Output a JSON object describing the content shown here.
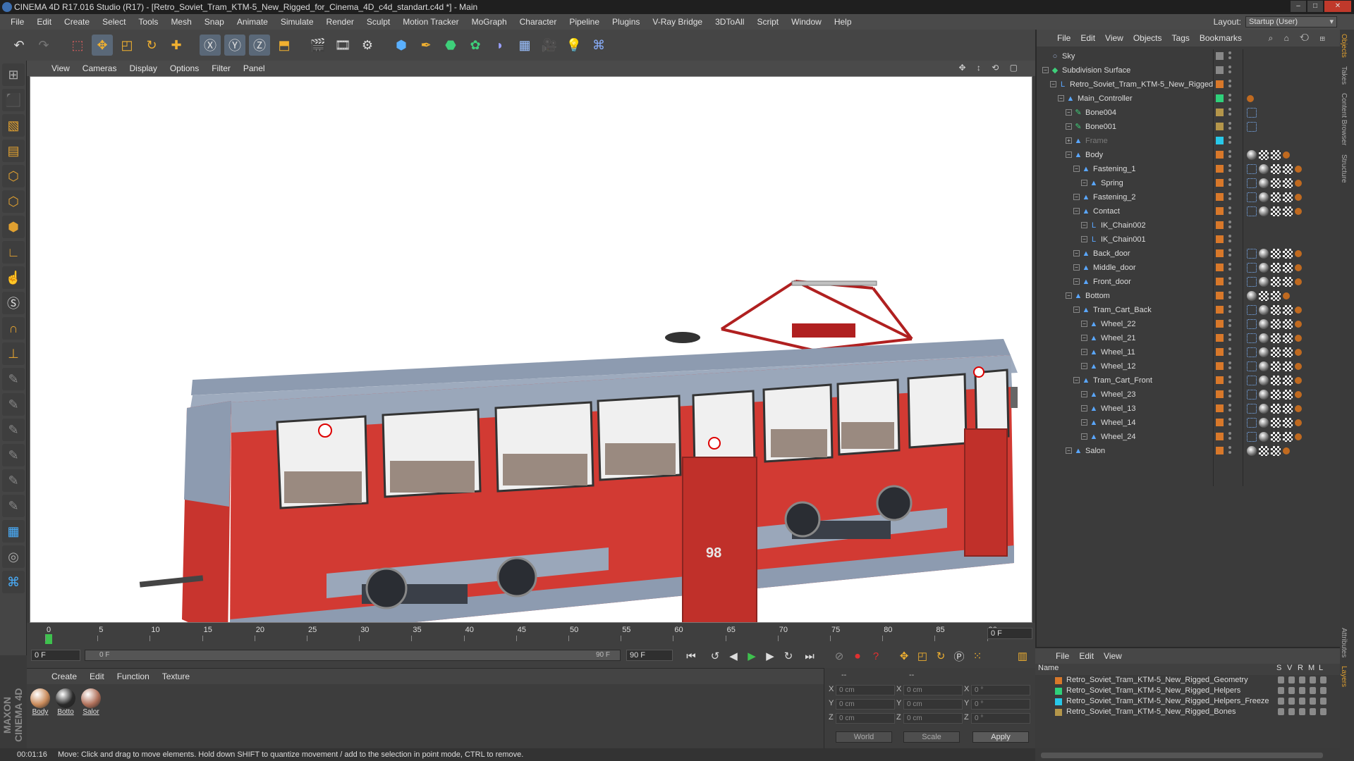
{
  "window": {
    "title": "CINEMA 4D R17.016 Studio (R17) - [Retro_Soviet_Tram_KTM-5_New_Rigged_for_Cinema_4D_c4d_standart.c4d *] - Main"
  },
  "menu": [
    "File",
    "Edit",
    "Create",
    "Select",
    "Tools",
    "Mesh",
    "Snap",
    "Animate",
    "Simulate",
    "Render",
    "Sculpt",
    "Motion Tracker",
    "MoGraph",
    "Character",
    "Pipeline",
    "Plugins",
    "V-Ray Bridge",
    "3DToAll",
    "Script",
    "Window",
    "Help"
  ],
  "layout": {
    "label": "Layout:",
    "value": "Startup (User)"
  },
  "viewport_menu": [
    "View",
    "Cameras",
    "Display",
    "Options",
    "Filter",
    "Panel"
  ],
  "tram": {
    "number": "98"
  },
  "timeline": {
    "ticks": [
      "0",
      "5",
      "10",
      "15",
      "20",
      "25",
      "30",
      "35",
      "40",
      "45",
      "50",
      "55",
      "60",
      "65",
      "70",
      "75",
      "80",
      "85",
      "90"
    ],
    "frame_field": "0 F",
    "start_field": "0 F",
    "slider_start": "0 F",
    "slider_end": "90 F",
    "end_field": "90 F"
  },
  "materials_menu": [
    "Create",
    "Edit",
    "Function",
    "Texture"
  ],
  "materials": [
    {
      "label": "Body",
      "color": "#c98a5a"
    },
    {
      "label": "Botto",
      "color": "#2a2a2a"
    },
    {
      "label": "Salor",
      "color": "#b0705a"
    }
  ],
  "coords": {
    "header_left": "--",
    "header_right": "--",
    "x_label": "X",
    "y_label": "Y",
    "z_label": "Z",
    "x_pos": "0 cm",
    "y_pos": "0 cm",
    "z_pos": "0 cm",
    "x_size": "0 cm",
    "y_size": "0 cm",
    "z_size": "0 cm",
    "h_rot": "0 °",
    "p_rot": "0 °",
    "b_rot": "0 °",
    "world": "World",
    "scale": "Scale",
    "apply": "Apply"
  },
  "status": {
    "time": "00:01:16",
    "message": "Move: Click and drag to move elements. Hold down SHIFT to quantize movement / add to the selection in point mode, CTRL to remove."
  },
  "objects_menu": [
    "File",
    "Edit",
    "View",
    "Objects",
    "Tags",
    "Bookmarks"
  ],
  "objects": [
    {
      "name": "Sky",
      "level": 0,
      "icon": "○",
      "color": "#888",
      "tags": ""
    },
    {
      "name": "Subdivision Surface",
      "level": 0,
      "icon": "◆",
      "color": "#888",
      "tags": ""
    },
    {
      "name": "Retro_Soviet_Tram_KTM-5_New_Rigged",
      "level": 1,
      "icon": "L",
      "color": "#d8782a",
      "tags": ""
    },
    {
      "name": "Main_Controller",
      "level": 2,
      "icon": "▲",
      "color": "#2fd07a",
      "tags": "ik"
    },
    {
      "name": "Bone004",
      "level": 3,
      "icon": "✎",
      "color": "#b4964a",
      "tags": "fx"
    },
    {
      "name": "Bone001",
      "level": 3,
      "icon": "✎",
      "color": "#b4964a",
      "tags": "fx"
    },
    {
      "name": "Frame",
      "level": 3,
      "icon": "▲",
      "color": "#28c8e8",
      "tags": "",
      "gray": true
    },
    {
      "name": "Body",
      "level": 3,
      "icon": "▲",
      "color": "#d8782a",
      "tags": "bcci"
    },
    {
      "name": "Fastening_1",
      "level": 4,
      "icon": "▲",
      "color": "#d8782a",
      "tags": "fbcci"
    },
    {
      "name": "Spring",
      "level": 5,
      "icon": "▲",
      "color": "#d8782a",
      "tags": "fbcci"
    },
    {
      "name": "Fastening_2",
      "level": 4,
      "icon": "▲",
      "color": "#d8782a",
      "tags": "fbcci"
    },
    {
      "name": "Contact",
      "level": 4,
      "icon": "▲",
      "color": "#d8782a",
      "tags": "fbcci"
    },
    {
      "name": "IK_Chain002",
      "level": 5,
      "icon": "L",
      "color": "#d8782a",
      "tags": ""
    },
    {
      "name": "IK_Chain001",
      "level": 5,
      "icon": "L",
      "color": "#d8782a",
      "tags": ""
    },
    {
      "name": "Back_door",
      "level": 4,
      "icon": "▲",
      "color": "#d8782a",
      "tags": "fbcci"
    },
    {
      "name": "Middle_door",
      "level": 4,
      "icon": "▲",
      "color": "#d8782a",
      "tags": "fbcci"
    },
    {
      "name": "Front_door",
      "level": 4,
      "icon": "▲",
      "color": "#d8782a",
      "tags": "fbcci"
    },
    {
      "name": "Bottom",
      "level": 3,
      "icon": "▲",
      "color": "#d8782a",
      "tags": "bcci"
    },
    {
      "name": "Tram_Cart_Back",
      "level": 4,
      "icon": "▲",
      "color": "#d8782a",
      "tags": "fbcci"
    },
    {
      "name": "Wheel_22",
      "level": 5,
      "icon": "▲",
      "color": "#d8782a",
      "tags": "fbcci"
    },
    {
      "name": "Wheel_21",
      "level": 5,
      "icon": "▲",
      "color": "#d8782a",
      "tags": "fbcci"
    },
    {
      "name": "Wheel_11",
      "level": 5,
      "icon": "▲",
      "color": "#d8782a",
      "tags": "fbcci"
    },
    {
      "name": "Wheel_12",
      "level": 5,
      "icon": "▲",
      "color": "#d8782a",
      "tags": "fbcci"
    },
    {
      "name": "Tram_Cart_Front",
      "level": 4,
      "icon": "▲",
      "color": "#d8782a",
      "tags": "fbcci"
    },
    {
      "name": "Wheel_23",
      "level": 5,
      "icon": "▲",
      "color": "#d8782a",
      "tags": "fbcci"
    },
    {
      "name": "Wheel_13",
      "level": 5,
      "icon": "▲",
      "color": "#d8782a",
      "tags": "fbcci"
    },
    {
      "name": "Wheel_14",
      "level": 5,
      "icon": "▲",
      "color": "#d8782a",
      "tags": "fbcci"
    },
    {
      "name": "Wheel_24",
      "level": 5,
      "icon": "▲",
      "color": "#d8782a",
      "tags": "fbcci"
    },
    {
      "name": "Salon",
      "level": 3,
      "icon": "▲",
      "color": "#d8782a",
      "tags": "bcci"
    }
  ],
  "layers_menu": [
    "File",
    "Edit",
    "View"
  ],
  "layers_columns": {
    "name": "Name",
    "s": "S",
    "v": "V",
    "r": "R",
    "m": "M",
    "l": "L"
  },
  "layers": [
    {
      "name": "Retro_Soviet_Tram_KTM-5_New_Rigged_Geometry",
      "color": "#d8782a"
    },
    {
      "name": "Retro_Soviet_Tram_KTM-5_New_Rigged_Helpers",
      "color": "#2fd07a"
    },
    {
      "name": "Retro_Soviet_Tram_KTM-5_New_Rigged_Helpers_Freeze",
      "color": "#28c8e8"
    },
    {
      "name": "Retro_Soviet_Tram_KTM-5_New_Rigged_Bones",
      "color": "#b4964a"
    }
  ],
  "side_tabs": [
    "Objects",
    "Takes",
    "Content Browser",
    "Structure"
  ],
  "side_tabs_bottom": [
    "Attributes",
    "Layers"
  ]
}
